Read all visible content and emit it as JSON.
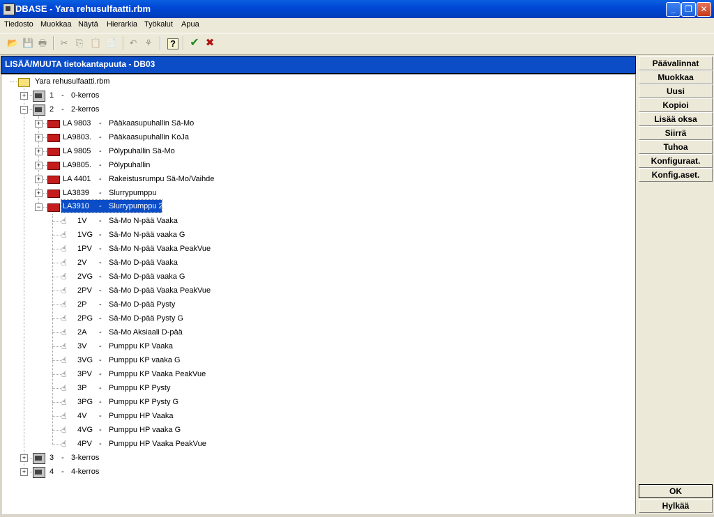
{
  "window": {
    "title": "DBASE - Yara rehusulfaatti.rbm"
  },
  "menu": [
    "Tiedosto",
    "Muokkaa",
    "Näytä",
    "Hierarkia",
    "Työkalut",
    "Apua"
  ],
  "toolbar": [
    {
      "icon": "open-folder-icon",
      "enabled": true
    },
    {
      "icon": "save-icon",
      "enabled": false
    },
    {
      "icon": "print-icon",
      "enabled": false
    },
    {
      "icon": "cut-icon",
      "enabled": false
    },
    {
      "icon": "copy-icon",
      "enabled": false
    },
    {
      "icon": "paste-icon",
      "enabled": false
    },
    {
      "icon": "paste-special-icon",
      "enabled": false
    },
    {
      "icon": "back-arrow-icon",
      "enabled": false
    },
    {
      "icon": "tree-icon",
      "enabled": false
    },
    {
      "icon": "help-icon",
      "enabled": true
    },
    {
      "icon": "ok-check-icon",
      "enabled": true
    },
    {
      "icon": "cancel-x-icon",
      "enabled": true
    }
  ],
  "panel": {
    "title": "LISÄÄ/MUUTA tietokantapuuta - DB03"
  },
  "tree": {
    "root": "Yara rehusulfaatti.rbm",
    "levels": [
      {
        "num": "1",
        "dash": "-",
        "name": "0-kerros",
        "expanded": false
      },
      {
        "num": "2",
        "dash": "-",
        "name": "2-kerros",
        "expanded": true
      },
      {
        "num": "3",
        "dash": "-",
        "name": "3-kerros",
        "expanded": false
      },
      {
        "num": "4",
        "dash": "-",
        "name": "4-kerros",
        "expanded": false
      }
    ],
    "machines": [
      {
        "code": "LA 9803",
        "dash": "-",
        "name": "Pääkaasupuhallin Sä-Mo"
      },
      {
        "code": "LA9803.",
        "dash": "-",
        "name": "Pääkaasupuhallin KoJa"
      },
      {
        "code": "LA 9805",
        "dash": "-",
        "name": "Pölypuhallin Sä-Mo"
      },
      {
        "code": "LA9805.",
        "dash": "-",
        "name": "Pölypuhallin"
      },
      {
        "code": "LA 4401",
        "dash": "-",
        "name": "Rakeistusrumpu Sä-Mo/Vaihde"
      },
      {
        "code": "LA3839",
        "dash": "-",
        "name": "Slurrypumppu"
      },
      {
        "code": "LA3910",
        "dash": "-",
        "name": "Slurrypumppu 2",
        "selected": true
      }
    ],
    "points": [
      {
        "code": "1V",
        "dash": "-",
        "name": "Sä-Mo N-pää Vaaka"
      },
      {
        "code": "1VG",
        "dash": "-",
        "name": "Sä-Mo N-pää vaaka G"
      },
      {
        "code": "1PV",
        "dash": "-",
        "name": "Sä-Mo N-pää Vaaka PeakVue"
      },
      {
        "code": "2V",
        "dash": "-",
        "name": "Sä-Mo D-pää Vaaka"
      },
      {
        "code": "2VG",
        "dash": "-",
        "name": "Sä-Mo D-pää vaaka G"
      },
      {
        "code": "2PV",
        "dash": "-",
        "name": "Sä-Mo D-pää Vaaka PeakVue"
      },
      {
        "code": "2P",
        "dash": "-",
        "name": "Sä-Mo D-pää Pysty"
      },
      {
        "code": "2PG",
        "dash": "-",
        "name": "Sä-Mo D-pää Pysty G"
      },
      {
        "code": "2A",
        "dash": "-",
        "name": "Sä-Mo Aksiaali D-pää"
      },
      {
        "code": "3V",
        "dash": "-",
        "name": "Pumppu KP Vaaka"
      },
      {
        "code": "3VG",
        "dash": "-",
        "name": "Pumppu KP vaaka G"
      },
      {
        "code": "3PV",
        "dash": "-",
        "name": "Pumppu KP Vaaka PeakVue"
      },
      {
        "code": "3P",
        "dash": "-",
        "name": "Pumppu KP Pysty"
      },
      {
        "code": "3PG",
        "dash": "-",
        "name": "Pumppu KP Pysty G"
      },
      {
        "code": "4V",
        "dash": "-",
        "name": "Pumppu HP Vaaka"
      },
      {
        "code": "4VG",
        "dash": "-",
        "name": "Pumppu HP vaaka G"
      },
      {
        "code": "4PV",
        "dash": "-",
        "name": "Pumppu HP Vaaka PeakVue"
      }
    ]
  },
  "side_buttons": [
    "Päävalinnat",
    "Muokkaa",
    "Uusi",
    "Kopioi",
    "Lisää oksa",
    "Siirrä",
    "Tuhoa",
    "Konfiguraat.",
    "Konfig.aset."
  ],
  "dialog_buttons": {
    "ok": "OK",
    "cancel": "Hylkää"
  }
}
